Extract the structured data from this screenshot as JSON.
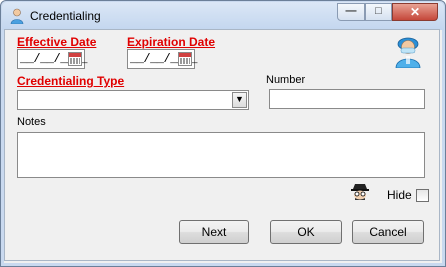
{
  "window": {
    "title": "Credentialing",
    "min_glyph": "—",
    "max_glyph": "□",
    "close_glyph": "✕"
  },
  "form": {
    "effective_date": {
      "label": "Effective Date",
      "mask": "__/__/____"
    },
    "expiration_date": {
      "label": "Expiration Date",
      "mask": "__/__/____"
    },
    "credentialing_type": {
      "label": "Credentialing Type",
      "value": ""
    },
    "number": {
      "label": "Number",
      "value": ""
    },
    "notes": {
      "label": "Notes",
      "value": ""
    },
    "hide": {
      "label": "Hide",
      "checked": false
    }
  },
  "buttons": {
    "next": "Next",
    "ok": "OK",
    "cancel": "Cancel"
  },
  "icons": {
    "title": "person-icon",
    "avatar": "doctor-avatar-icon",
    "hide": "spy-icon",
    "calendar": "calendar-icon",
    "dropdown": "chevron-down-icon"
  }
}
